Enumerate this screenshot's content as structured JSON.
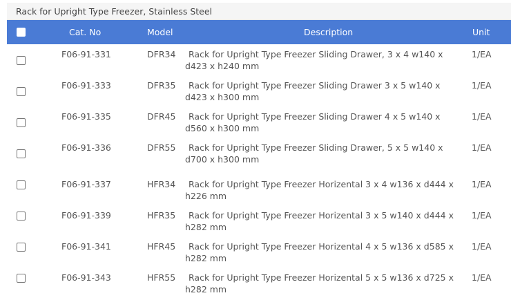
{
  "section": {
    "title": "Rack for Upright Type Freezer, Stainless Steel"
  },
  "table": {
    "headers": {
      "cat_no": "Cat. No",
      "model": "Model",
      "description": "Description",
      "unit": "Unit"
    },
    "rows": [
      {
        "cat_no": "F06-91-331",
        "model": "DFR34",
        "description": "Rack for Upright Type Freezer Sliding Drawer, 3 x 4 w140 x d423 x h240 mm",
        "unit": "1/EA"
      },
      {
        "cat_no": "F06-91-333",
        "model": "DFR35",
        "description": "Rack for Upright Type Freezer Sliding Drawer 3 x 5 w140 x d423 x h300 mm",
        "unit": "1/EA"
      },
      {
        "cat_no": "F06-91-335",
        "model": "DFR45",
        "description": "Rack for Upright Type Freezer Sliding Drawer 4 x 5 w140 x d560 x h300 mm",
        "unit": "1/EA"
      },
      {
        "cat_no": "F06-91-336",
        "model": "DFR55",
        "description": "Rack for Upright Type Freezer Sliding Drawer, 5 x 5 w140 x d700 x h300 mm",
        "unit": "1/EA"
      },
      {
        "cat_no": "F06-91-337",
        "model": "HFR34",
        "description": "Rack for Upright Type Freezer Horizental 3 x 4 w136 x d444 x h226 mm",
        "unit": "1/EA"
      },
      {
        "cat_no": "F06-91-339",
        "model": "HFR35",
        "description": "Rack for Upright Type Freezer Horizental 3 x 5 w140 x d444 x h282 mm",
        "unit": "1/EA"
      },
      {
        "cat_no": "F06-91-341",
        "model": "HFR45",
        "description": "Rack for Upright Type Freezer Horizental 4 x 5 w136 x d585 x h282 mm",
        "unit": "1/EA"
      },
      {
        "cat_no": "F06-91-343",
        "model": "HFR55",
        "description": "Rack for Upright Type Freezer Horizental 5 x 5 w136 x d725 x h282 mm",
        "unit": "1/EA"
      }
    ]
  },
  "colors": {
    "header_bg": "#4a7bd5",
    "title_bg": "#f5f5f5",
    "text": "#555555"
  }
}
